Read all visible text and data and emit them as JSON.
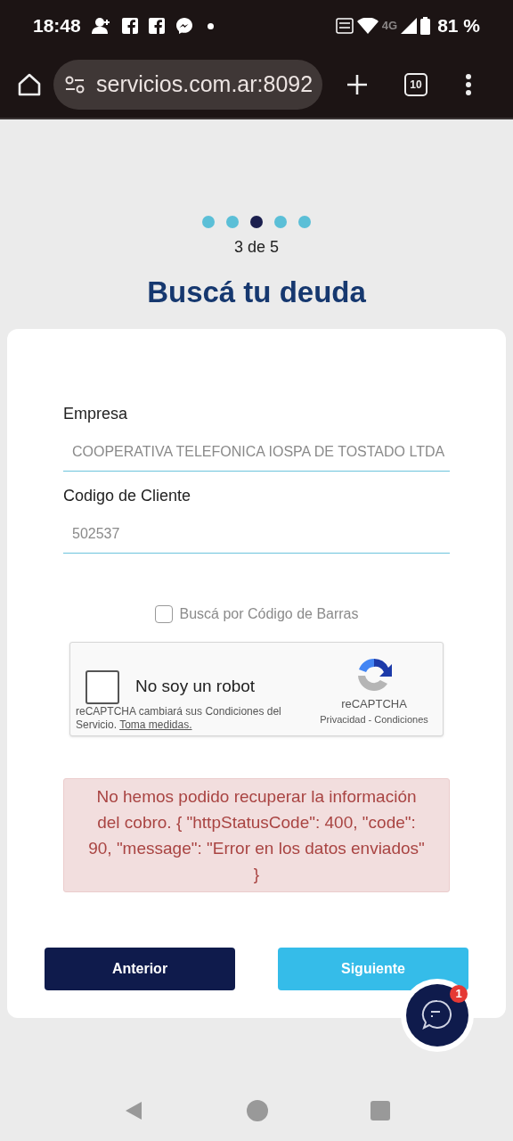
{
  "status_bar": {
    "time": "18:48",
    "battery": "81 %",
    "network": "4G"
  },
  "browser": {
    "url": "servicios.com.ar:8092",
    "tab_count": "10"
  },
  "steps": [
    {
      "selected": false
    },
    {
      "selected": false
    },
    {
      "selected": true
    },
    {
      "selected": false
    },
    {
      "selected": false
    }
  ],
  "step_label": "3 de 5",
  "title": "Buscá tu deuda",
  "fields": [
    {
      "label": "Empresa",
      "value": "COOPERATIVA TELEFONICA IOSPA DE TOSTADO LTDA"
    },
    {
      "label": "Codigo de Cliente",
      "value": "502537"
    }
  ],
  "barcode_option": {
    "label": "Buscá por Código de Barras",
    "checked": false
  },
  "captcha": {
    "label": "No soy un robot",
    "checked": false,
    "brand": "reCAPTCHA",
    "notice": "reCAPTCHA cambiará sus Condiciones del Servicio.",
    "notice_link": "Toma medidas.",
    "privacy": "Privacidad",
    "separator": "-",
    "terms": "Condiciones"
  },
  "error": "No hemos podido recuperar la información del cobro. { \"httpStatusCode\": 400, \"code\": 90, \"message\": \"Error en los datos enviados\" }",
  "buttons": {
    "back": "Anterior",
    "next": "Siguiente"
  },
  "chat": {
    "badge": "1"
  }
}
